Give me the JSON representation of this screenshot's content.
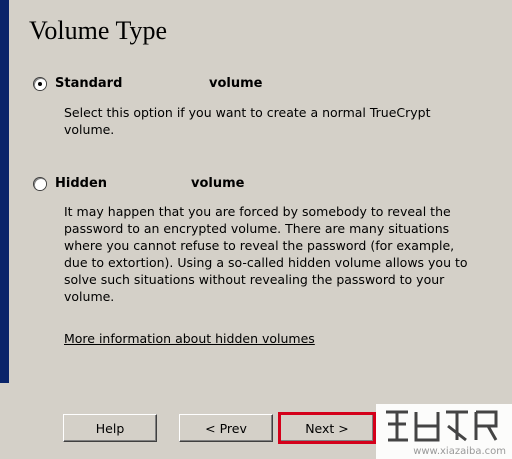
{
  "page": {
    "title": "Volume Type"
  },
  "options": [
    {
      "label": "Standard",
      "word": "volume",
      "checked": true,
      "description_lines": [
        "Select this option if you want to create a normal TrueCrypt",
        "volume."
      ]
    },
    {
      "label": "Hidden",
      "word": "volume",
      "checked": false,
      "description_lines": [
        "It may happen that you are forced by somebody to reveal the",
        "password to an encrypted volume. There are many situations",
        "where you cannot refuse to reveal the password (for example,",
        "due to extortion). Using a so-called hidden volume allows you to",
        "solve such situations without revealing the password to your",
        "volume."
      ]
    }
  ],
  "more_info_link": "More information about hidden volumes",
  "buttons": {
    "help": "Help",
    "prev": "< Prev",
    "next": "Next >"
  },
  "watermark": {
    "url": "www.xiazaiba.com"
  },
  "colors": {
    "rail": "#0a246a",
    "dialog_bg": "#d4d0c8",
    "highlight_outline": "#d4001a"
  }
}
